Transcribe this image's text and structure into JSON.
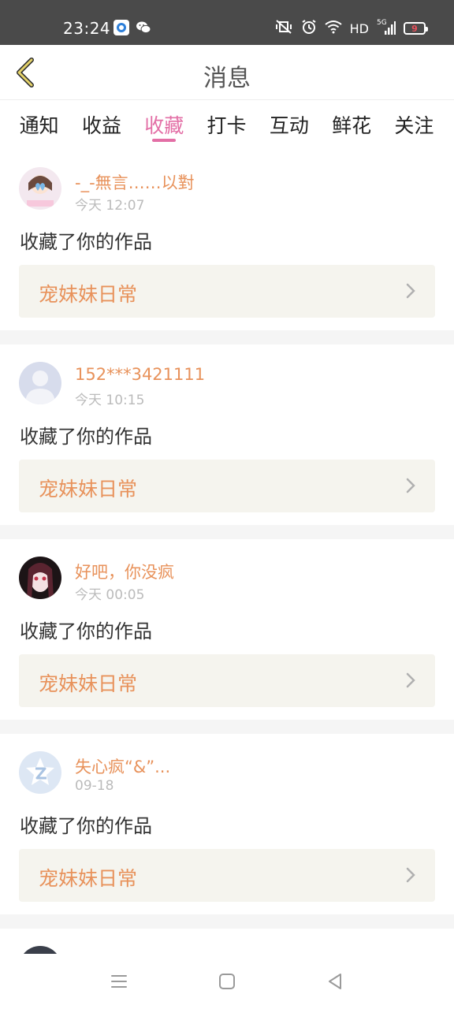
{
  "status_bar": {
    "time": "23:24",
    "network_label": "HD",
    "signal_label": "5G",
    "battery_level": "9"
  },
  "header": {
    "title": "消息"
  },
  "tabs": [
    {
      "label": "通知"
    },
    {
      "label": "收益"
    },
    {
      "label": "收藏"
    },
    {
      "label": "打卡"
    },
    {
      "label": "互动"
    },
    {
      "label": "鲜花"
    },
    {
      "label": "关注"
    }
  ],
  "active_tab": "收藏",
  "notifications": [
    {
      "username": "-_-無言……以對",
      "time": "今天 12:07",
      "action": "收藏了你的作品",
      "work_title": "宠妹妹日常"
    },
    {
      "username": "152***3421111",
      "time": "今天 10:15",
      "action": "收藏了你的作品",
      "work_title": "宠妹妹日常"
    },
    {
      "username": "好吧，你没疯",
      "time": "今天 00:05",
      "action": "收藏了你的作品",
      "work_title": "宠妹妹日常"
    },
    {
      "username": "失心疯“&”...",
      "time": "09-18",
      "action": "收藏了你的作品",
      "work_title": "宠妹妹日常"
    }
  ],
  "colors": {
    "accent_pink": "#e36fa6",
    "username_orange": "#e8925b",
    "card_bg": "#f5f4ee",
    "status_bar_bg": "#4a4a4a"
  }
}
